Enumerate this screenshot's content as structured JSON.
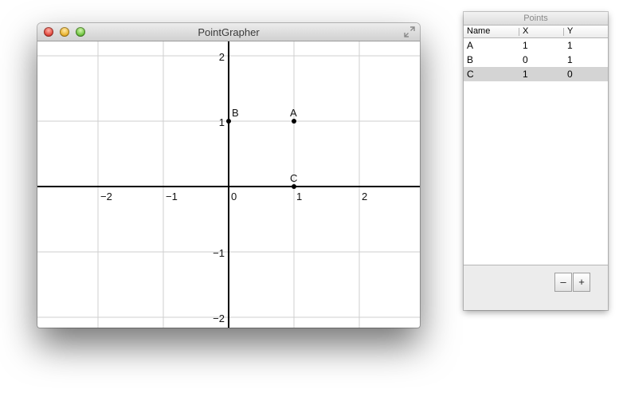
{
  "main_window": {
    "title": "PointGrapher"
  },
  "graph": {
    "axis_ticks_x": [
      "−2",
      "−1",
      "0",
      "1",
      "2"
    ],
    "axis_ticks_y": [
      "2",
      "1",
      "−1",
      "−2"
    ],
    "points": [
      {
        "name": "A",
        "x": 1,
        "y": 1
      },
      {
        "name": "B",
        "x": 0,
        "y": 1
      },
      {
        "name": "C",
        "x": 1,
        "y": 0
      }
    ]
  },
  "points_panel": {
    "title": "Points",
    "columns": {
      "name": "Name",
      "x": "X",
      "y": "Y"
    },
    "rows": [
      {
        "name": "A",
        "x": "1",
        "y": "1",
        "selected": false
      },
      {
        "name": "B",
        "x": "0",
        "y": "1",
        "selected": false
      },
      {
        "name": "C",
        "x": "1",
        "y": "0",
        "selected": true
      }
    ],
    "remove_label": "–",
    "add_label": "+"
  }
}
